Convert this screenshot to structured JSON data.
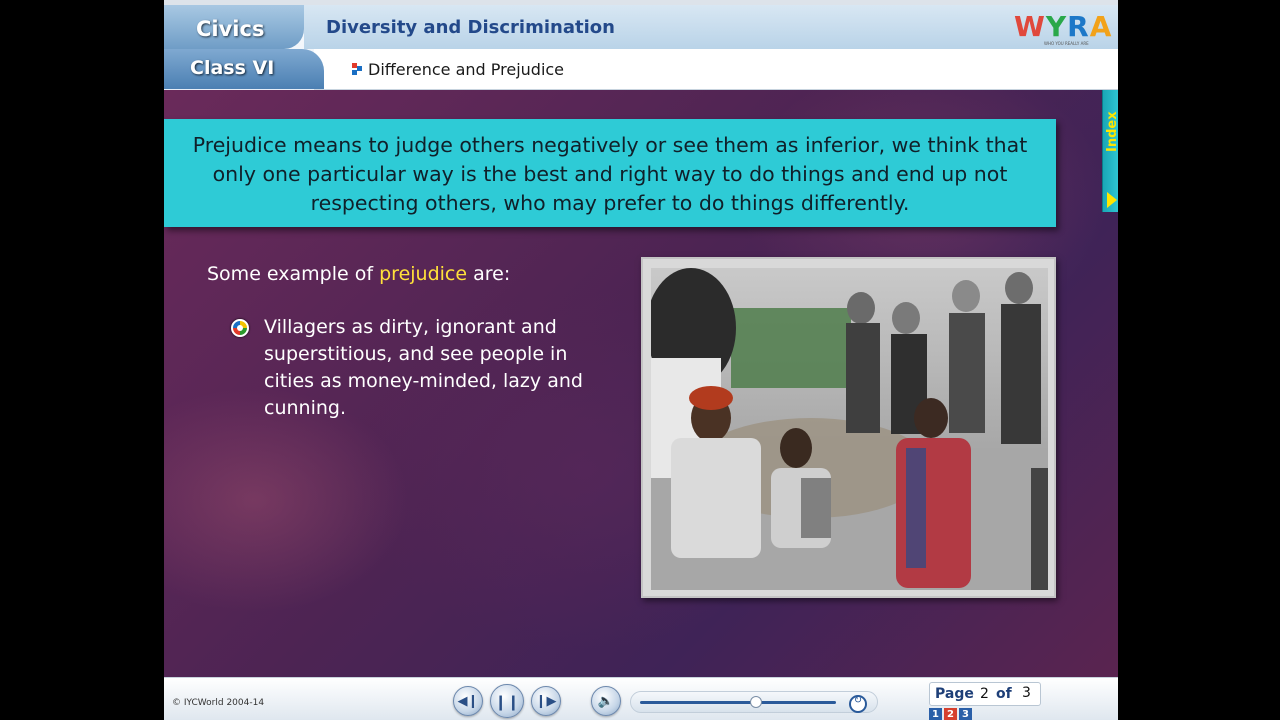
{
  "header": {
    "subject": "Civics",
    "class_label": "Class VI",
    "chapter_title": "Diversity and Discrimination",
    "topic_title": "Difference and Prejudice",
    "logo_text": "WYRA",
    "logo_tagline": "WHO YOU REALLY ARE"
  },
  "side_tab": {
    "label": "Index"
  },
  "content": {
    "definition": "Prejudice means to judge others negatively or see them as inferior, we think that only one particular way is the best and right way to do things and end up not respecting others, who may prefer to do things differently.",
    "intro_prefix": "Some example of ",
    "intro_highlight": "prejudice",
    "intro_suffix": " are:",
    "bullets": [
      {
        "text": "Villagers as dirty, ignorant and superstitious, and see people in cities as money-minded, lazy and cunning."
      }
    ]
  },
  "footer": {
    "copyright": "© IYCWorld 2004-14",
    "page_label": "Page",
    "current_page": "2",
    "of_label": "of",
    "total_pages": "3",
    "page_chips": [
      "1",
      "2",
      "3"
    ],
    "playback_progress_percent": 59
  },
  "colors": {
    "definition_bg": "#2ecbd6",
    "highlight": "#ffe13a",
    "title_blue": "#23498a"
  },
  "icons": {
    "prev": "skip-back-icon",
    "pause": "pause-icon",
    "next": "skip-forward-icon",
    "volume": "speaker-icon",
    "replay": "replay-icon",
    "bullet": "multicolor-bullet-icon"
  }
}
